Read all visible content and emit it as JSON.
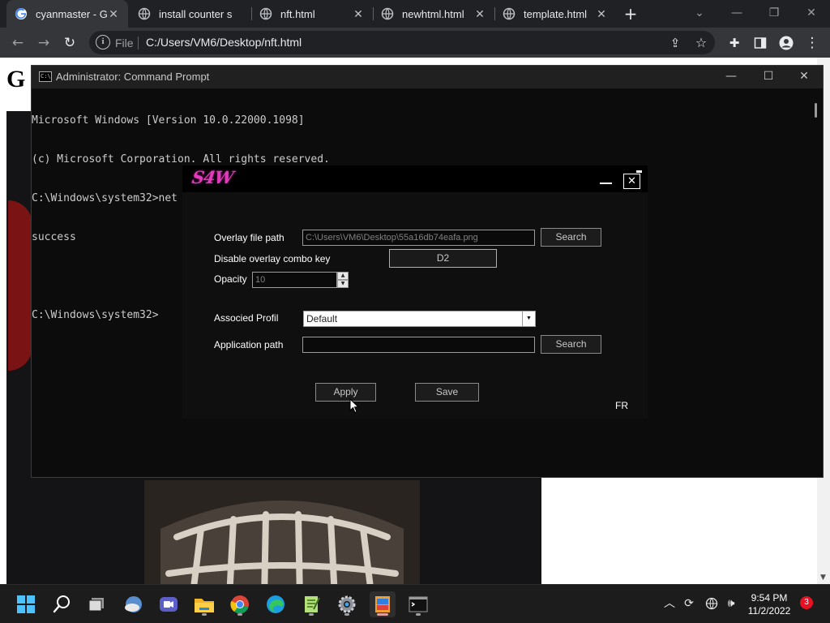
{
  "browser": {
    "tabs": [
      {
        "label": "cyanmaster - Go",
        "icon": "google-icon"
      },
      {
        "label": "install counter s",
        "icon": "globe-icon"
      },
      {
        "label": "nft.html",
        "icon": "globe-icon"
      },
      {
        "label": "newhtml.html",
        "icon": "globe-icon"
      },
      {
        "label": "template.html",
        "icon": "globe-icon"
      }
    ],
    "active_tab": 0,
    "address": {
      "scheme_label": "File",
      "url": "C:/Users/VM6/Desktop/nft.html"
    }
  },
  "page": {
    "heading": "G"
  },
  "cmd": {
    "title": "Administrator: Command Prompt",
    "icon_text": "C:\\",
    "lines": [
      "Microsoft Windows [Version 10.0.22000.1098]",
      "(c) Microsoft Corporation. All rights reserved.",
      "C:\\Windows\\system32>net user",
      "success",
      "",
      "C:\\Windows\\system32>"
    ]
  },
  "s4w": {
    "logo": "S4W",
    "overlay_path_label": "Overlay file path",
    "overlay_path_value": "C:\\Users\\VM6\\Desktop\\55a16db74eafa.png",
    "search_label": "Search",
    "combo_key_label": "Disable overlay combo key",
    "combo_key_value": "D2",
    "opacity_label": "Opacity",
    "opacity_value": "10",
    "profile_label": "Associed Profil",
    "profile_value": "Default",
    "app_path_label": "Application path",
    "app_path_value": "",
    "apply_label": "Apply",
    "save_label": "Save",
    "language": "FR",
    "logo_color": "#e03bb8"
  },
  "taskbar": {
    "apps": [
      "start",
      "search",
      "task-view",
      "widgets",
      "teams-chat",
      "file-explorer",
      "chrome",
      "edge",
      "notepad-plus",
      "settings",
      "paint",
      "terminal"
    ],
    "time": "9:54 PM",
    "date": "11/2/2022",
    "notification_count": "3"
  }
}
